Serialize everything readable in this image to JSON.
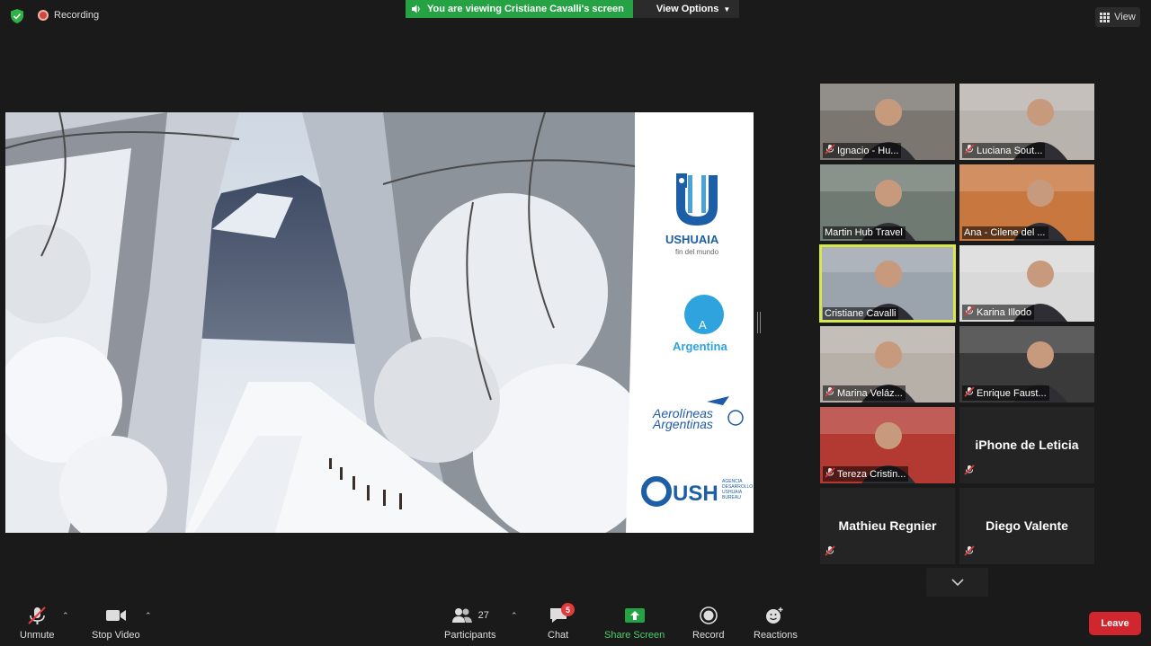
{
  "top": {
    "recording_label": "Recording",
    "viewing_text": "You are viewing Cristiane Cavalli's screen",
    "view_options_label": "View Options",
    "view_label": "View"
  },
  "slide": {
    "brand1_title": "USHUAIA",
    "brand1_sub": "fin del mundo",
    "brand2_letter": "A",
    "brand2_title": "Argentina",
    "brand3_line1": "Aerolíneas",
    "brand3_line2": "Argentinas",
    "brand4_title": "USH",
    "brand4_line1": "AGENCIA",
    "brand4_line2": "DESARROLLO",
    "brand4_line3": "USHUAIA",
    "brand4_line4": "BUREAU"
  },
  "gallery": {
    "participants": [
      {
        "name": "Ignacio - Hu...",
        "muted": true,
        "video": true
      },
      {
        "name": "Luciana Sout...",
        "muted": true,
        "video": true
      },
      {
        "name": "Martin Hub Travel",
        "muted": false,
        "video": true
      },
      {
        "name": "Ana - Cilene del ...",
        "muted": false,
        "video": true
      },
      {
        "name": "Cristiane Cavalli",
        "muted": false,
        "video": true,
        "active": true
      },
      {
        "name": "Karina Illodo",
        "muted": true,
        "video": true
      },
      {
        "name": "Marina Veláz...",
        "muted": true,
        "video": true
      },
      {
        "name": "Enrique Faust...",
        "muted": true,
        "video": true
      },
      {
        "name": "Tereza Cristin...",
        "muted": true,
        "video": true
      },
      {
        "name": "iPhone de Leticia",
        "muted": true,
        "video": false
      },
      {
        "name": "Mathieu Regnier",
        "muted": true,
        "video": false
      },
      {
        "name": "Diego Valente",
        "muted": true,
        "video": false
      }
    ]
  },
  "toolbar": {
    "unmute": "Unmute",
    "stop_video": "Stop Video",
    "participants": "Participants",
    "participants_count": "27",
    "chat": "Chat",
    "chat_badge": "5",
    "share_screen": "Share Screen",
    "record": "Record",
    "reactions": "Reactions",
    "leave": "Leave"
  },
  "colors": {
    "share_green": "#25a244",
    "active_speaker": "#d7e84b",
    "leave_red": "#d2262e",
    "ushuaia_blue": "#1d5fa6",
    "argentina_blue": "#2ea3dd"
  }
}
